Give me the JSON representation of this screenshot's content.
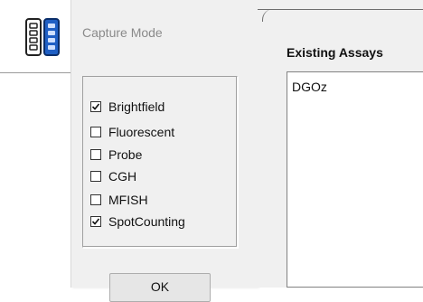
{
  "capture_dialog": {
    "title": "Capture Mode",
    "options": [
      {
        "label": "Brightfield",
        "checked": true
      },
      {
        "label": "Fluorescent",
        "checked": false
      },
      {
        "label": "Probe",
        "checked": false
      },
      {
        "label": "CGH",
        "checked": false
      },
      {
        "label": "MFISH",
        "checked": false
      },
      {
        "label": "SpotCounting",
        "checked": true
      }
    ],
    "ok_label": "OK"
  },
  "assays": {
    "heading": "Existing Assays",
    "items": [
      "DGOz"
    ]
  },
  "icons": {
    "app_icon": "slide-tray-icon",
    "checkmark": "checkmark-icon"
  },
  "colors": {
    "dialog_bg": "#f0f0f0",
    "icon_blue": "#1f5fc4",
    "title_gray": "#8a8a8a"
  }
}
